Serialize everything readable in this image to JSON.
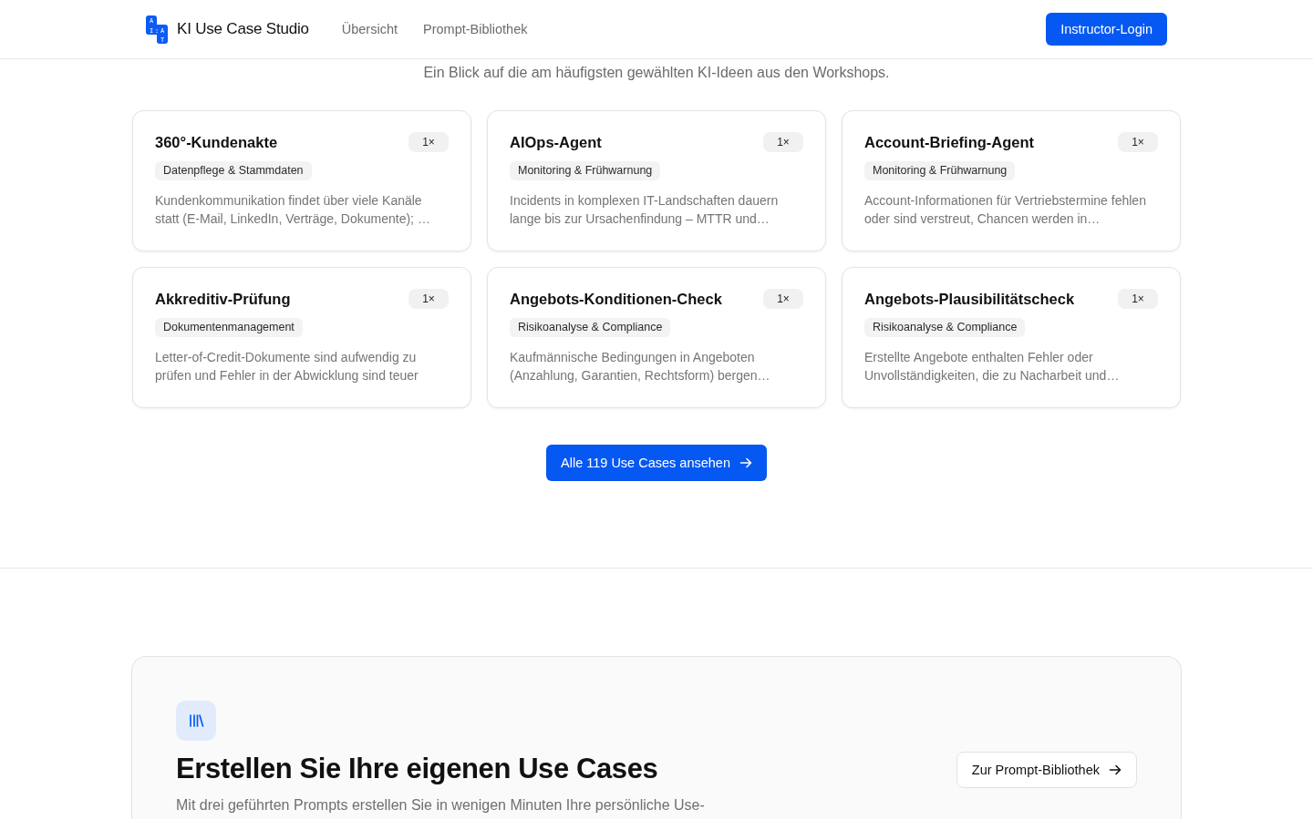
{
  "header": {
    "logo_letters": [
      "A",
      "I",
      ":",
      "A",
      "T"
    ],
    "brand": "KI Use Case Studio",
    "nav": [
      {
        "label": "Übersicht",
        "selected": false
      },
      {
        "label": "Prompt-Bibliothek",
        "selected": false
      }
    ],
    "login_button": "Instructor-Login"
  },
  "popular": {
    "subtitle": "Ein Blick auf die am häufigsten gewählten KI-Ideen aus den Workshops.",
    "cards": [
      {
        "title": "360°-Kundenakte",
        "count": "1×",
        "category": "Datenpflege & Stammdaten",
        "description": "Kundenkommunikation findet über viele Kanäle statt (E-Mail, LinkedIn, Verträge, Dokumente); …"
      },
      {
        "title": "AIOps-Agent",
        "count": "1×",
        "category": "Monitoring & Frühwarnung",
        "description": "Incidents in komplexen IT-Landschaften dauern lange bis zur Ursachenfindung – MTTR und…"
      },
      {
        "title": "Account-Briefing-Agent",
        "count": "1×",
        "category": "Monitoring & Frühwarnung",
        "description": "Account-Informationen für Vertriebstermine fehlen oder sind verstreut, Chancen werden in…"
      },
      {
        "title": "Akkreditiv-Prüfung",
        "count": "1×",
        "category": "Dokumentenmanagement",
        "description": "Letter-of-Credit-Dokumente sind aufwendig zu prüfen und Fehler in der Abwicklung sind teuer"
      },
      {
        "title": "Angebots-Konditionen-Check",
        "count": "1×",
        "category": "Risikoanalyse & Compliance",
        "description": "Kaufmännische Bedingungen in Angeboten (Anzahlung, Garantien, Rechtsform) bergen…"
      },
      {
        "title": "Angebots-Plausibilitätscheck",
        "count": "1×",
        "category": "Risikoanalyse & Compliance",
        "description": "Erstellte Angebote enthalten Fehler oder Unvollständigkeiten, die zu Nacharbeit und…"
      }
    ],
    "all_button": "Alle 119 Use Cases ansehen"
  },
  "cta": {
    "title": "Erstellen Sie Ihre eigenen Use Cases",
    "text": "Mit drei geführten Prompts erstellen Sie in wenigen Minuten Ihre persönliche Use-",
    "button": "Zur Prompt-Bibliothek"
  }
}
